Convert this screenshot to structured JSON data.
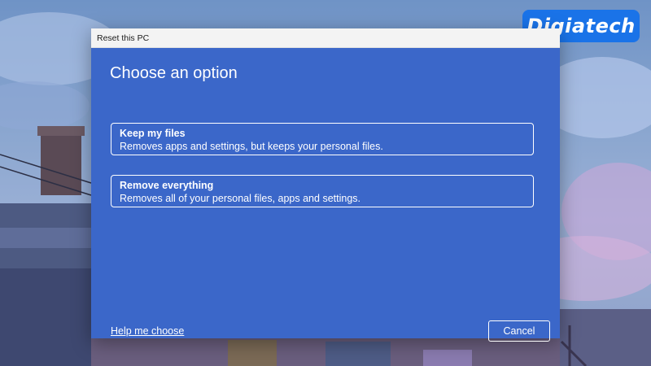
{
  "brand": {
    "logo_text": "Digiatech",
    "logo_color": "#1a73e8"
  },
  "dialog": {
    "title": "Reset this PC",
    "heading": "Choose an option",
    "background_color": "#3b67c9",
    "options": [
      {
        "title": "Keep my files",
        "description": "Removes apps and settings, but keeps your personal files."
      },
      {
        "title": "Remove everything",
        "description": "Removes all of your personal files, apps and settings."
      }
    ],
    "help_link": "Help me choose",
    "cancel_label": "Cancel"
  }
}
